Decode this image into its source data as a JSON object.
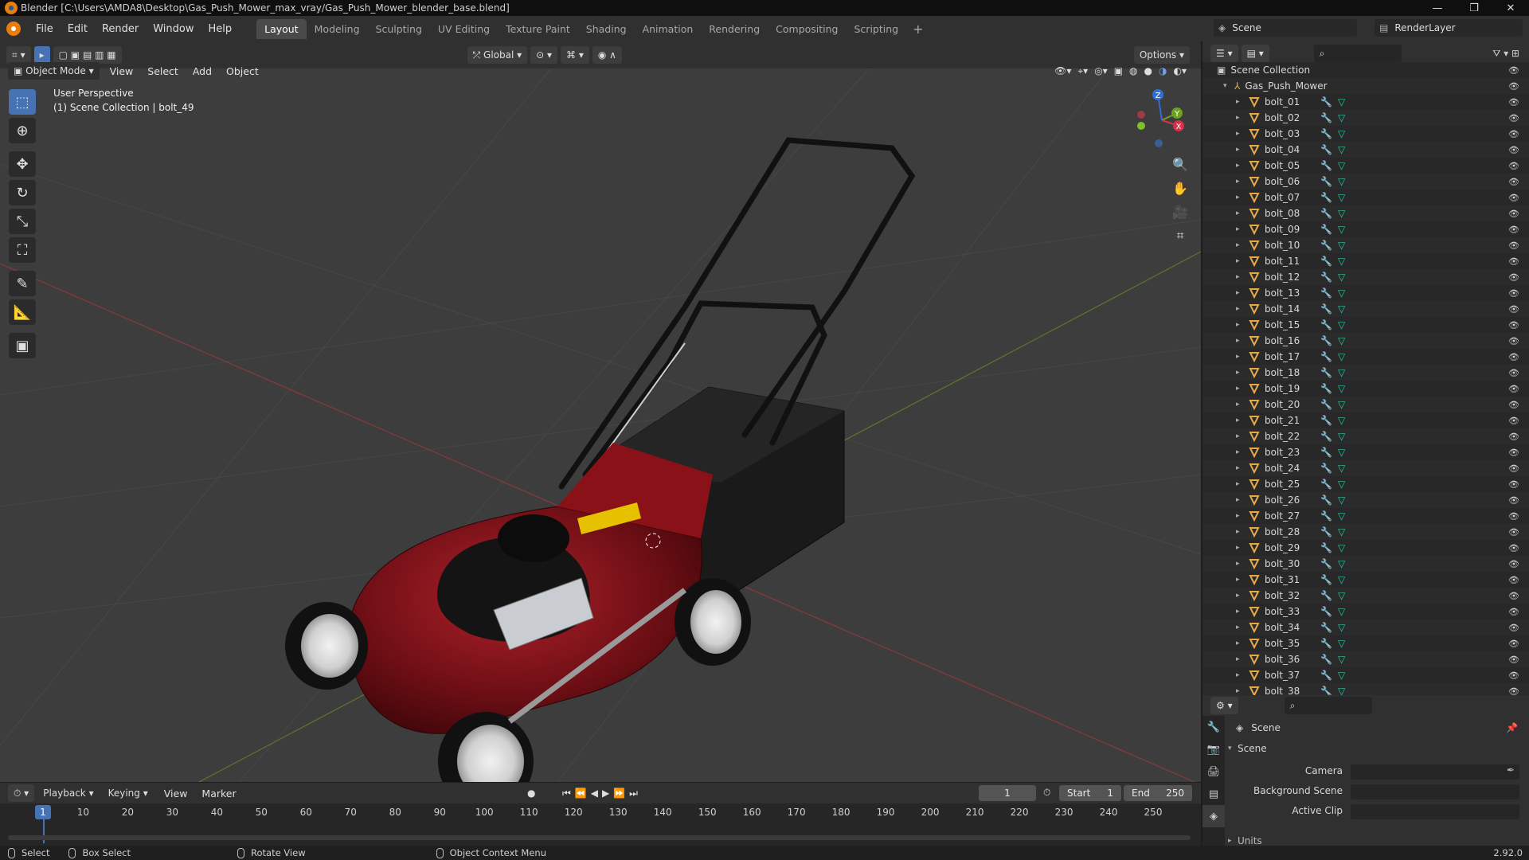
{
  "window": {
    "title": "Blender [C:\\Users\\AMDA8\\Desktop\\Gas_Push_Mower_max_vray/Gas_Push_Mower_blender_base.blend]",
    "minimize": "—",
    "maximize": "❐",
    "close": "✕"
  },
  "menu": [
    "File",
    "Edit",
    "Render",
    "Window",
    "Help"
  ],
  "workspaces": [
    {
      "label": "Layout",
      "active": true
    },
    {
      "label": "Modeling"
    },
    {
      "label": "Sculpting"
    },
    {
      "label": "UV Editing"
    },
    {
      "label": "Texture Paint"
    },
    {
      "label": "Shading"
    },
    {
      "label": "Animation"
    },
    {
      "label": "Rendering"
    },
    {
      "label": "Compositing"
    },
    {
      "label": "Scripting"
    }
  ],
  "top_right": {
    "scene": "Scene",
    "render_layer": "RenderLayer"
  },
  "viewport_header": {
    "mode": "Object Mode",
    "menus": [
      "View",
      "Select",
      "Add",
      "Object"
    ],
    "orientation": "Global",
    "options": "Options"
  },
  "viewport_info": {
    "line1": "User Perspective",
    "line2": "(1) Scene Collection | bolt_49"
  },
  "gizmo": {
    "z": "Z",
    "y": "Y",
    "x": "X"
  },
  "outliner": {
    "root": "Scene Collection",
    "collection": "Gas_Push_Mower",
    "items": [
      "bolt_01",
      "bolt_02",
      "bolt_03",
      "bolt_04",
      "bolt_05",
      "bolt_06",
      "bolt_07",
      "bolt_08",
      "bolt_09",
      "bolt_10",
      "bolt_11",
      "bolt_12",
      "bolt_13",
      "bolt_14",
      "bolt_15",
      "bolt_16",
      "bolt_17",
      "bolt_18",
      "bolt_19",
      "bolt_20",
      "bolt_21",
      "bolt_22",
      "bolt_23",
      "bolt_24",
      "bolt_25",
      "bolt_26",
      "bolt_27",
      "bolt_28",
      "bolt_29",
      "bolt_30",
      "bolt_31",
      "bolt_32",
      "bolt_33",
      "bolt_34",
      "bolt_35",
      "bolt_36",
      "bolt_37",
      "bolt_38"
    ]
  },
  "properties": {
    "context": "Scene",
    "panel": "Scene",
    "camera_label": "Camera",
    "background_label": "Background Scene",
    "clip_label": "Active Clip",
    "units": "Units"
  },
  "timeline": {
    "menus": [
      "Playback",
      "Keying",
      "View",
      "Marker"
    ],
    "current_frame": "1",
    "start_label": "Start",
    "start": "1",
    "end_label": "End",
    "end": "250",
    "ticks": [
      "1",
      "10",
      "20",
      "30",
      "40",
      "50",
      "60",
      "70",
      "80",
      "90",
      "100",
      "110",
      "120",
      "130",
      "140",
      "150",
      "160",
      "170",
      "180",
      "190",
      "200",
      "210",
      "220",
      "230",
      "240",
      "250"
    ]
  },
  "status": {
    "select": "Select",
    "box_select": "Box Select",
    "rotate": "Rotate View",
    "context_menu": "Object Context Menu",
    "version": "2.92.0"
  },
  "colors": {
    "accent": "#4772b3",
    "mesh": "#25c9a3",
    "modifier": "#6f9fe0",
    "object": "#e8a84a"
  }
}
